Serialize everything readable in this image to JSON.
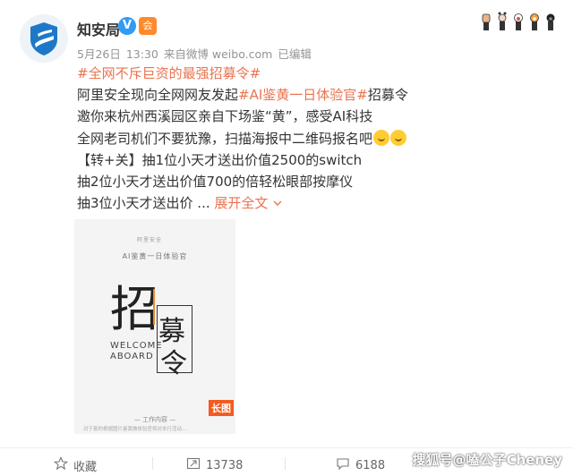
{
  "account": {
    "name": "知安局",
    "verified_mark": "V",
    "badge": "会"
  },
  "meta": {
    "date": "5月26日",
    "time": "13:30",
    "source_prefix": "来自",
    "source": "微博 weibo.com",
    "edited": "已编辑"
  },
  "top_icons": [
    "raised-fist-icon",
    "cat-paw-icon",
    "lion-paw-icon",
    "fox-paw-icon",
    "bear-paw-icon"
  ],
  "post": {
    "topic1": "#全网不斥巨资的最强招募令#",
    "line2_a": "阿里安全现向全网网友发起",
    "topic2": "#AI鉴黄一日体验官#",
    "line2_b": "招募令",
    "line3": "邀你来杭州西溪园区亲自下场鉴“黄”，感受AI科技",
    "line4": "全网老司机们不要犹豫，扫描海报中二维码报名吧",
    "line5": "【转+关】抽1位小天才送出价值2500的switch",
    "line6": "抽2位小天才送出价值700的倍轻松眼部按摩仪",
    "line7": "抽3位小天才送出价 ...",
    "expand": "展开全文",
    "expand_icon": "chevron-down-icon"
  },
  "poster": {
    "logo": "阿里安全",
    "title": "AI鉴黄一日体验官",
    "big1": "招",
    "big2": "募",
    "big3": "令",
    "welcome_1": "WELCOME",
    "welcome_2": "ABOARD",
    "work": "— 工作内容 —",
    "work_sub": "对于套的根据图片鉴黄做体验官将对本行活动...",
    "long_badge": "长图"
  },
  "footer": {
    "favorite": "收藏",
    "repost": "13738",
    "comment": "6188"
  },
  "watermark": "搜狐号@嗑公子Cheney"
}
